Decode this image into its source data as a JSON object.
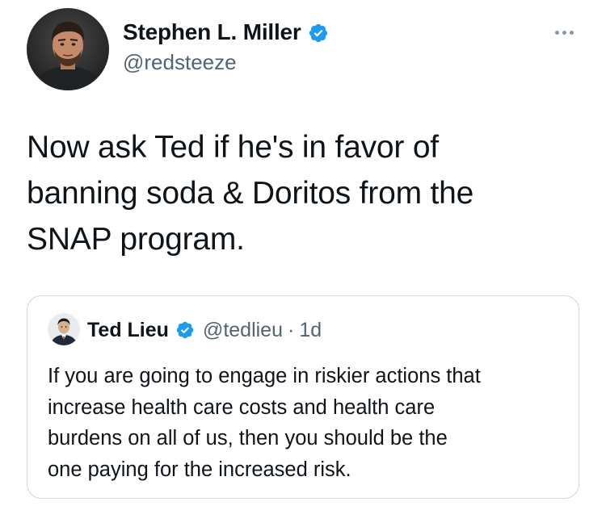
{
  "tweet": {
    "author": {
      "display_name": "Stephen L. Miller",
      "handle": "@redsteeze",
      "verified": true,
      "avatar_icon": "profile-photo"
    },
    "more_icon": "more-horizontal-icon",
    "text": "Now ask Ted if he's in favor of\nbanning soda & Doritos from the\nSNAP program."
  },
  "quoted_tweet": {
    "author": {
      "display_name": "Ted Lieu",
      "handle": "@tedlieu",
      "verified": true,
      "avatar_icon": "profile-photo"
    },
    "separator": "·",
    "timestamp": "1d",
    "text": "If you are going to engage in riskier actions that\nincrease health care costs and health care\nburdens on all of us, then you should be the\none paying for the increased risk."
  },
  "colors": {
    "verified_blue": "#1d9bf0",
    "text_primary": "#0f1419",
    "text_secondary": "#536471",
    "border": "#cfd9de"
  }
}
